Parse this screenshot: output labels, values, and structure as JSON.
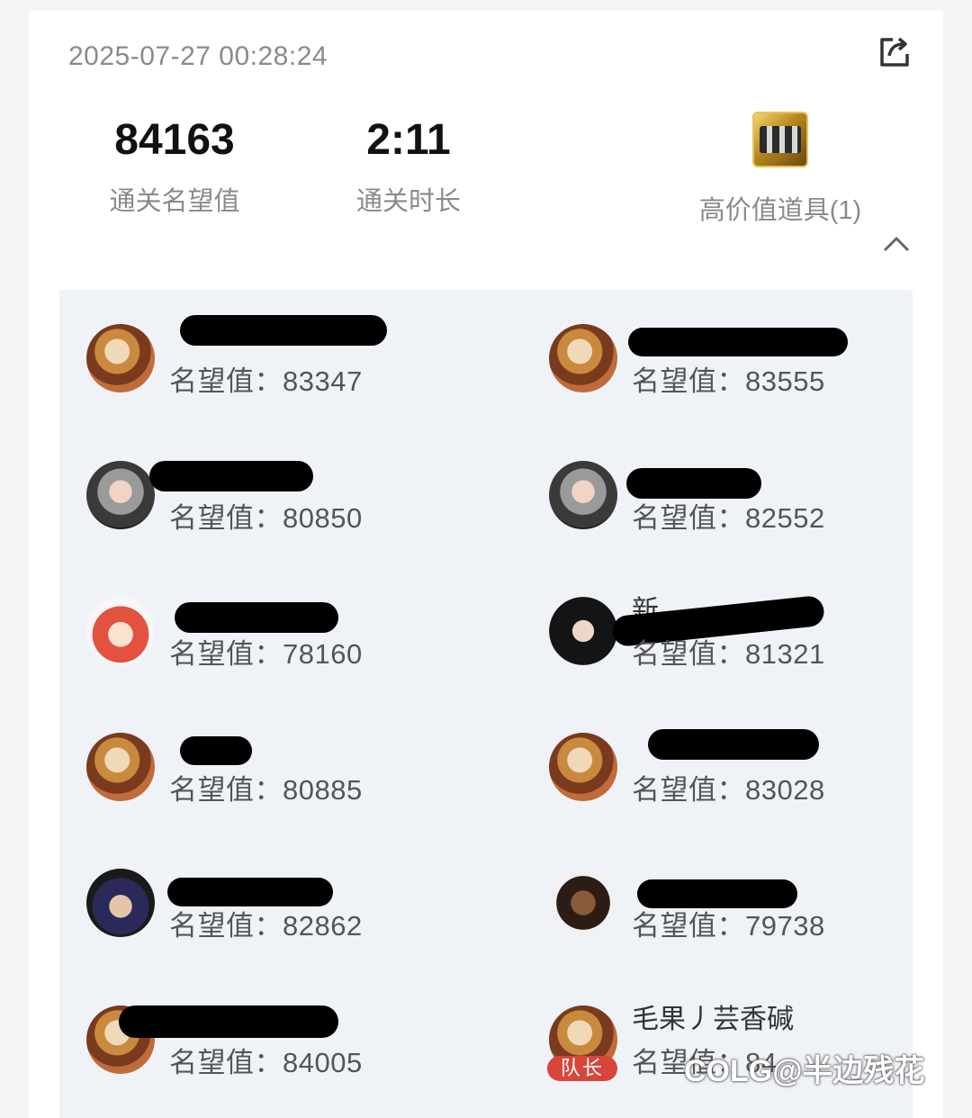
{
  "header": {
    "timestamp": "2025-07-27 00:28:24"
  },
  "stats": {
    "fame_value": "84163",
    "fame_label": "通关名望值",
    "time_value": "2:11",
    "time_label": "通关时长",
    "item_label": "高价值道具(1)"
  },
  "players": [
    {
      "fame": "名望值：83347",
      "avatar": "avatar-armored"
    },
    {
      "fame": "名望值：83555",
      "avatar": "avatar-armored"
    },
    {
      "fame": "名望值：80850",
      "avatar": "avatar-silver-hair"
    },
    {
      "fame": "名望值：82552",
      "avatar": "avatar-silver-hair"
    },
    {
      "fame": "名望值：78160",
      "avatar": "avatar-red-hair"
    },
    {
      "name_visible": "新",
      "fame": "名望值：81321",
      "avatar": "avatar-dark-hair"
    },
    {
      "fame": "名望值：80885",
      "avatar": "avatar-armored"
    },
    {
      "fame": "名望值：83028",
      "avatar": "avatar-armored"
    },
    {
      "fame": "名望值：82862",
      "avatar": "avatar-blue-hair"
    },
    {
      "fame": "名望值：79738",
      "avatar": "avatar-bearded-man"
    },
    {
      "fame": "名望值：84005",
      "avatar": "avatar-armored"
    },
    {
      "name": "毛果丿芸香碱",
      "fame": "名望值：84",
      "avatar": "avatar-armored",
      "badge": "队长"
    }
  ],
  "watermark": "@半边残花",
  "watermark_logo": "COLG"
}
